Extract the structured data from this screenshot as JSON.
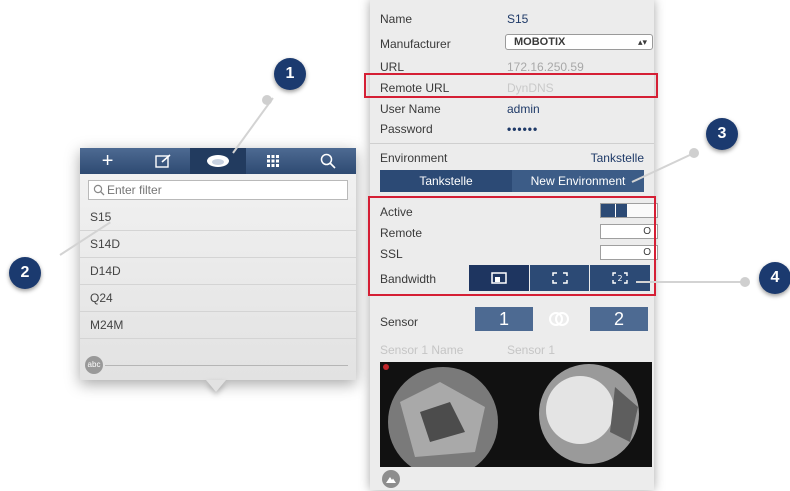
{
  "left_panel": {
    "toolbar": [
      {
        "name": "add-camera-icon",
        "glyph": "+"
      },
      {
        "name": "edit-icon",
        "glyph": "✎"
      },
      {
        "name": "camera-dome-icon",
        "glyph": ""
      },
      {
        "name": "grid-view-icon",
        "glyph": "☷"
      },
      {
        "name": "search-icon",
        "glyph": "⌕"
      }
    ],
    "filter_placeholder": "Enter filter",
    "cameras": [
      "S15",
      "S14D",
      "D14D",
      "Q24",
      "M24M"
    ],
    "sort_badge": "abc"
  },
  "right_panel": {
    "name_label": "Name",
    "name_value": "S15",
    "manufacturer_label": "Manufacturer",
    "manufacturer_value": "MOBOTIX",
    "url_label": "URL",
    "url_value": "172.16.250.59",
    "remote_url_label": "Remote URL",
    "remote_url_placeholder": "DynDNS",
    "user_label": "User Name",
    "user_value": "admin",
    "password_label": "Password",
    "password_value": "••••••",
    "environment_label": "Environment",
    "environment_value": "Tankstelle",
    "env_tabs": [
      "Tankstelle",
      "New Environment"
    ],
    "active_label": "Active",
    "active_toggle": "I",
    "remote_label": "Remote",
    "remote_toggle": "O",
    "ssl_label": "SSL",
    "ssl_toggle": "O",
    "bandwidth_label": "Bandwidth",
    "sensor_label": "Sensor",
    "sensor_1": "1",
    "sensor_2": "2",
    "sensor_name_label": "Sensor 1 Name",
    "sensor_name_value": "Sensor 1"
  },
  "callouts": [
    "1",
    "2",
    "3",
    "4"
  ],
  "colors": {
    "navy": "#1b3a6f",
    "toolbar": "#3d5a82",
    "highlight": "#d51f35"
  }
}
